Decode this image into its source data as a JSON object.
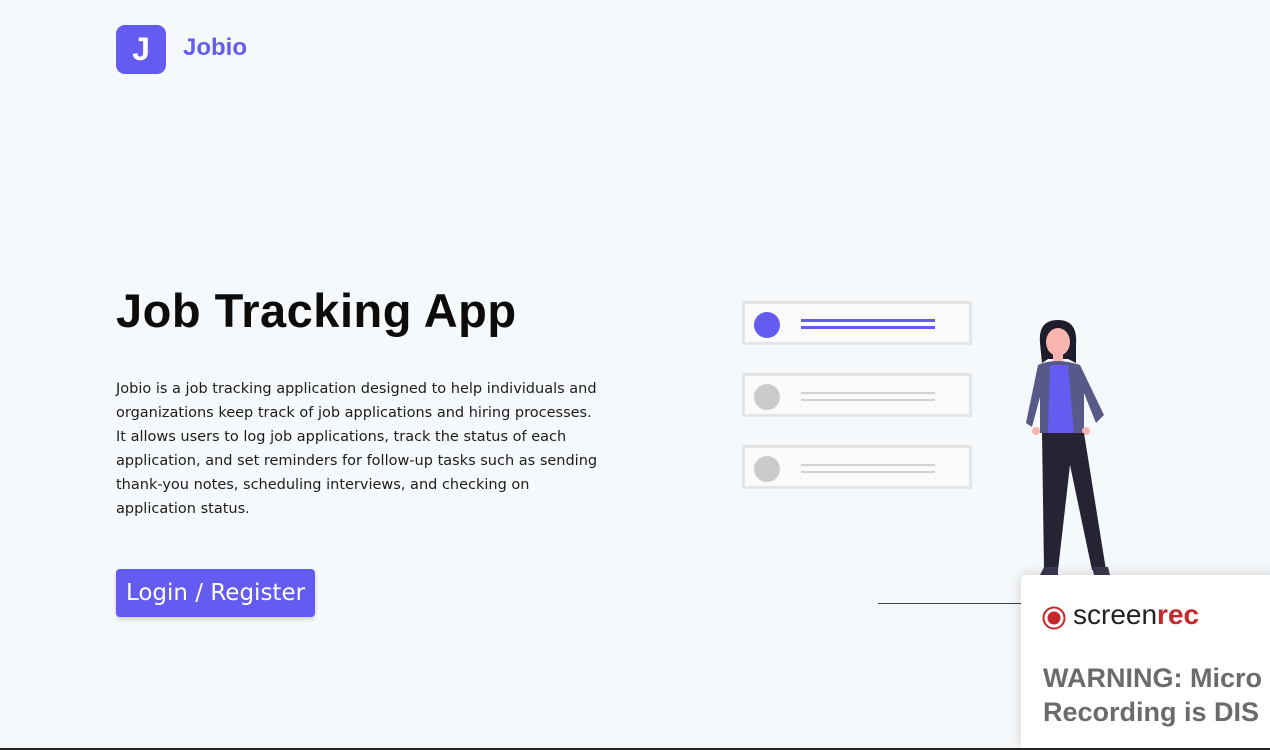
{
  "header": {
    "logo_letter": "J",
    "brand": "Jobio"
  },
  "hero": {
    "title": "Job Tracking App",
    "description": "Jobio is a job tracking application designed to help individuals and organizations keep track of job applications and hiring processes. It allows users to log job applications, track the status of each application, and set reminders for follow-up tasks such as sending thank-you notes, scheduling interviews, and checking on application status.",
    "login_button": "Login / Register"
  },
  "illustration": {
    "cards": [
      "active",
      "inactive",
      "inactive"
    ],
    "accent_color": "#645cf0"
  },
  "overlay": {
    "brand_prefix": "screen",
    "brand_suffix": "rec",
    "warning_line1": "WARNING: Micro",
    "warning_line2": "Recording is DIS"
  },
  "colors": {
    "accent": "#645cf0",
    "background": "#f6f9fb",
    "rec_red": "#c4282d"
  }
}
